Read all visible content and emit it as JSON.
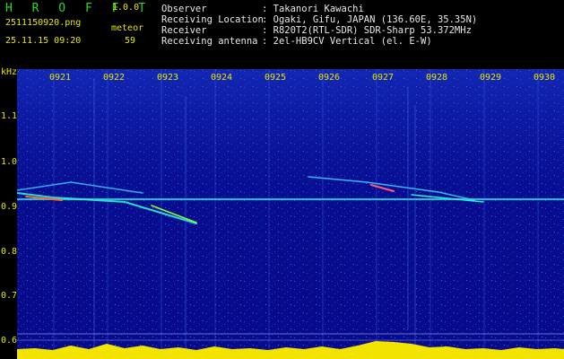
{
  "header": {
    "app_title": "H R O F F T",
    "app_version": "1.0.0",
    "filename": "2511150920.png",
    "detector_label": "meteor",
    "datetime": "25.11.15 09:20",
    "meteor_count": "59",
    "info": [
      {
        "label": "Observer",
        "value": ": Takanori Kawachi"
      },
      {
        "label": "Receiving Location",
        "value": ": Ogaki, Gifu, JAPAN (136.60E, 35.35N)"
      },
      {
        "label": "Receiver",
        "value": ": R820T2(RTL-SDR) SDR-Sharp 53.372MHz"
      },
      {
        "label": "Receiving antenna",
        "value": ": 2el-HB9CV Vertical (el. E-W)"
      }
    ]
  },
  "spectrogram": {
    "y_unit": "kHz",
    "y_ticks": [
      "1.1",
      "1.0",
      "0.9",
      "0.8",
      "0.7",
      "0.6"
    ],
    "x_ticks": [
      "0921",
      "0922",
      "0923",
      "0924",
      "0925",
      "0926",
      "0927",
      "0928",
      "0929",
      "0930"
    ],
    "colors": {
      "background": "#070a8a",
      "labels": "#e6e600",
      "carrier": "#19e0e8"
    }
  }
}
